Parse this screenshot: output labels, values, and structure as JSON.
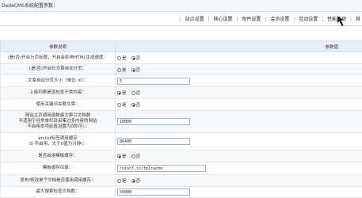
{
  "window": {
    "title": "DedeCMS系统配置参数："
  },
  "tabs": [
    {
      "label": "站点设置"
    },
    {
      "label": "核心设置"
    },
    {
      "label": "附件设置"
    },
    {
      "label": "会员设置"
    },
    {
      "label": "互动设置"
    },
    {
      "label": "性能选项"
    },
    {
      "label": "其"
    }
  ],
  "table": {
    "headers": [
      "参数说明",
      "参数值"
    ],
    "rows": [
      {
        "label": "(是/否)开启分页标题，开启会影响HTML生成速度：",
        "type": "radio",
        "options": [
          "是",
          "否"
        ],
        "selected": 1
      },
      {
        "label": "(是/否)开启长文章自动分页：",
        "type": "radio",
        "options": [
          "是",
          "否"
        ],
        "selected": 1
      },
      {
        "label": "文章自动分页大小（单位: K）：",
        "type": "input",
        "value": "5"
      },
      {
        "label": "上级列表是否包含子类内容：",
        "type": "radio",
        "options": [
          "是",
          "否"
        ],
        "selected": 0
      },
      {
        "label": "使用关键词关联文章：",
        "type": "radio",
        "options": [
          "是",
          "否"
        ],
        "selected": 1
      },
      {
        "label": "网站主页调用函数最大索引文档数\n不适用于经常单栏目采集过多内容的网站\n不启用本项此值设置为0即可)：",
        "type": "input",
        "value": "10000"
      },
      {
        "label": "arclist标签调用缓存\n(0 不启用，大于0值为分钟)：",
        "type": "input",
        "value": "86400"
      },
      {
        "label": "是否启用模板缓存：",
        "type": "radio",
        "options": [
          "是",
          "否"
        ],
        "selected": 0
      },
      {
        "label": "模板缓存目录：",
        "type": "input",
        "value": "/uincf.cc/tplcache"
      },
      {
        "label": "发布/修改单个文档是否使用调用缓存：",
        "type": "radio",
        "options": [
          "是",
          "否"
        ],
        "selected": 1
      },
      {
        "label": "最大搜索检查文档数：",
        "type": "input",
        "value": "50000"
      }
    ]
  },
  "colors": {
    "header_bg": "#e8eef3",
    "arrow": "#1a1a1a"
  }
}
